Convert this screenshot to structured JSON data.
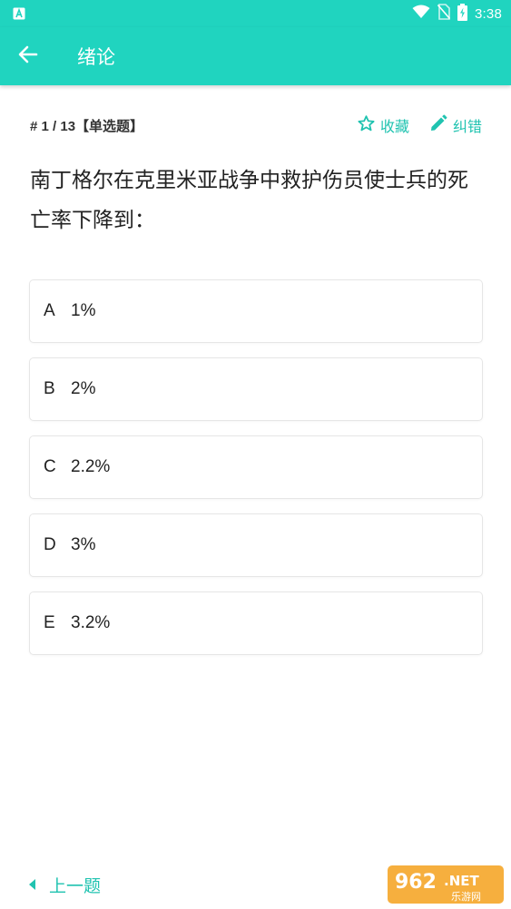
{
  "status_bar": {
    "time": "3:38",
    "icons": [
      "app-notification-icon",
      "wifi-icon",
      "no-sim-icon",
      "battery-charging-icon"
    ]
  },
  "app_bar": {
    "title": "绪论",
    "back_icon": "arrow-left-icon"
  },
  "question": {
    "number_label": "# 1 / 13【单选题】",
    "text": "南丁格尔在克里米亚战争中救护伤员使士兵的死亡率下降到：",
    "favorite_label": "收藏",
    "favorite_icon": "star-outline-icon",
    "correct_label": "纠错",
    "correct_icon": "pencil-icon"
  },
  "options": [
    {
      "letter": "A",
      "text": "1%"
    },
    {
      "letter": "B",
      "text": "2%"
    },
    {
      "letter": "C",
      "text": "2.2%"
    },
    {
      "letter": "D",
      "text": "3%"
    },
    {
      "letter": "E",
      "text": "3.2%"
    }
  ],
  "footer": {
    "prev_label": "上一题",
    "prev_icon": "caret-left-icon"
  },
  "watermark": {
    "site": "962.NET",
    "sub": "乐游网"
  },
  "colors": {
    "accent": "#20d4bf",
    "accent_text": "#20c3b0"
  }
}
